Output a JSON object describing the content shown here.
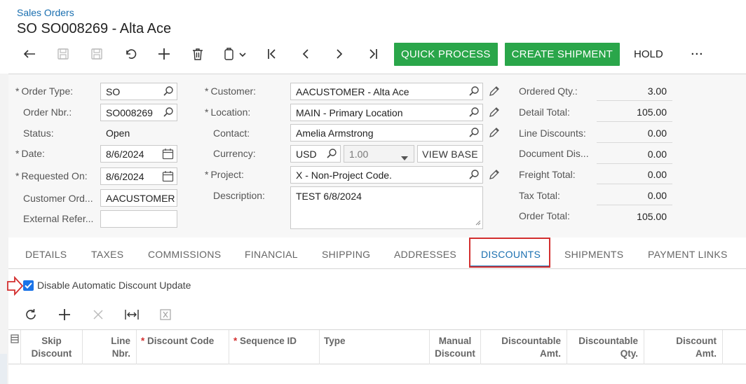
{
  "breadcrumb": "Sales Orders",
  "title": "SO SO008269 - Alta Ace",
  "toolbar": {
    "icons": [
      "back-icon",
      "save-icon",
      "save-close-icon",
      "undo-icon",
      "add-icon",
      "delete-icon",
      "copy-paste-icon",
      "first-icon",
      "prev-icon",
      "next-icon",
      "last-icon"
    ],
    "quick_process": "QUICK PROCESS",
    "create_shipment": "CREATE SHIPMENT",
    "hold": "HOLD",
    "more": "···"
  },
  "form": {
    "order_type": {
      "label": "Order Type:",
      "value": "SO",
      "required": "*"
    },
    "order_nbr": {
      "label": "Order Nbr.:",
      "value": "SO008269"
    },
    "status": {
      "label": "Status:",
      "value": "Open"
    },
    "date": {
      "label": "Date:",
      "value": "8/6/2024",
      "required": "*"
    },
    "requested_on": {
      "label": "Requested On:",
      "value": "8/6/2024",
      "required": "*"
    },
    "customer_ord": {
      "label": "Customer Ord...",
      "value": "AACUSTOMER"
    },
    "external_ref": {
      "label": "External Refer...",
      "value": ""
    },
    "customer": {
      "label": "Customer:",
      "value": "AACUSTOMER - Alta Ace",
      "required": "*"
    },
    "location": {
      "label": "Location:",
      "value": "MAIN - Primary Location",
      "required": "*"
    },
    "contact": {
      "label": "Contact:",
      "value": "Amelia Armstrong"
    },
    "currency": {
      "label": "Currency:",
      "value": "USD",
      "rate": "1.00",
      "view_base": "VIEW BASE"
    },
    "project": {
      "label": "Project:",
      "value": "X - Non-Project Code.",
      "required": "*"
    },
    "description": {
      "label": "Description:",
      "value": "TEST 6/8/2024"
    }
  },
  "summary": [
    {
      "label": "Ordered Qty.:",
      "value": "3.00"
    },
    {
      "label": "Detail Total:",
      "value": "105.00"
    },
    {
      "label": "Line Discounts:",
      "value": "0.00"
    },
    {
      "label": "Document Dis...",
      "value": "0.00"
    },
    {
      "label": "Freight Total:",
      "value": "0.00"
    },
    {
      "label": "Tax Total:",
      "value": "0.00"
    },
    {
      "label": "Order Total:",
      "value": "105.00"
    }
  ],
  "tabs": [
    "DETAILS",
    "TAXES",
    "COMMISSIONS",
    "FINANCIAL",
    "SHIPPING",
    "ADDRESSES",
    "DISCOUNTS",
    "SHIPMENTS",
    "PAYMENT LINKS"
  ],
  "active_tab": "DISCOUNTS",
  "checkbox": {
    "label": "Disable Automatic Discount Update",
    "checked": true
  },
  "grid_toolbar": [
    "refresh-icon",
    "add-row-icon",
    "delete-row-icon",
    "fit-columns-icon",
    "export-excel-icon"
  ],
  "columns": [
    {
      "line1": "Skip",
      "line2": "Discount"
    },
    {
      "line1": "Line",
      "line2": "Nbr."
    },
    {
      "line1": "Discount Code",
      "required": "*"
    },
    {
      "line1": "Sequence ID",
      "required": "*"
    },
    {
      "line1": "Type"
    },
    {
      "line1": "Manual",
      "line2": "Discount"
    },
    {
      "line1": "Discountable",
      "line2": "Amt."
    },
    {
      "line1": "Discountable",
      "line2": "Qty."
    },
    {
      "line1": "Discount",
      "line2": "Amt."
    }
  ],
  "colors": {
    "accent": "#1a6fb0",
    "green": "#2aa64a",
    "highlight": "#d32f2f"
  }
}
